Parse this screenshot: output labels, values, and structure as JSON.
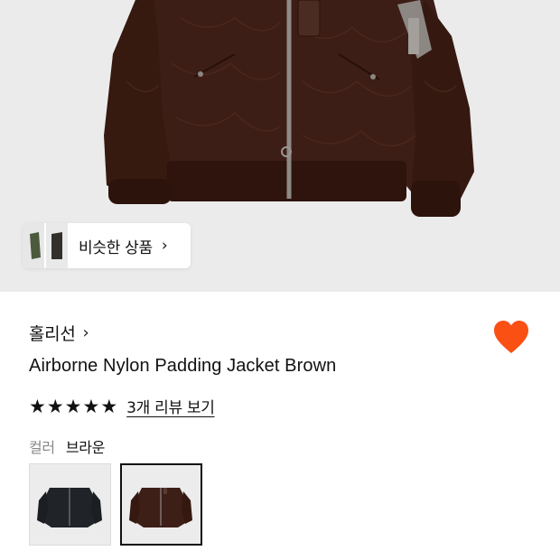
{
  "hero": {
    "similar_products_label": "비슷한 상품",
    "chevron": "›"
  },
  "brand": {
    "name": "홀리선",
    "chevron": "›"
  },
  "favorite": {
    "icon": "heart-icon",
    "color": "#fa5014",
    "active": true
  },
  "product": {
    "title": "Airborne Nylon Padding Jacket Brown"
  },
  "rating": {
    "stars": 5,
    "review_link": "3개 리뷰 보기"
  },
  "color_option": {
    "label": "컬러",
    "selected_value": "브라운",
    "swatches": [
      {
        "color": "#23262b",
        "selected": false
      },
      {
        "color": "#3e1f17",
        "selected": true
      }
    ]
  },
  "colors": {
    "jacket_brown": "#3d1e16",
    "jacket_black": "#202328",
    "hero_bg": "#ebebeb",
    "heart": "#fa5014"
  }
}
